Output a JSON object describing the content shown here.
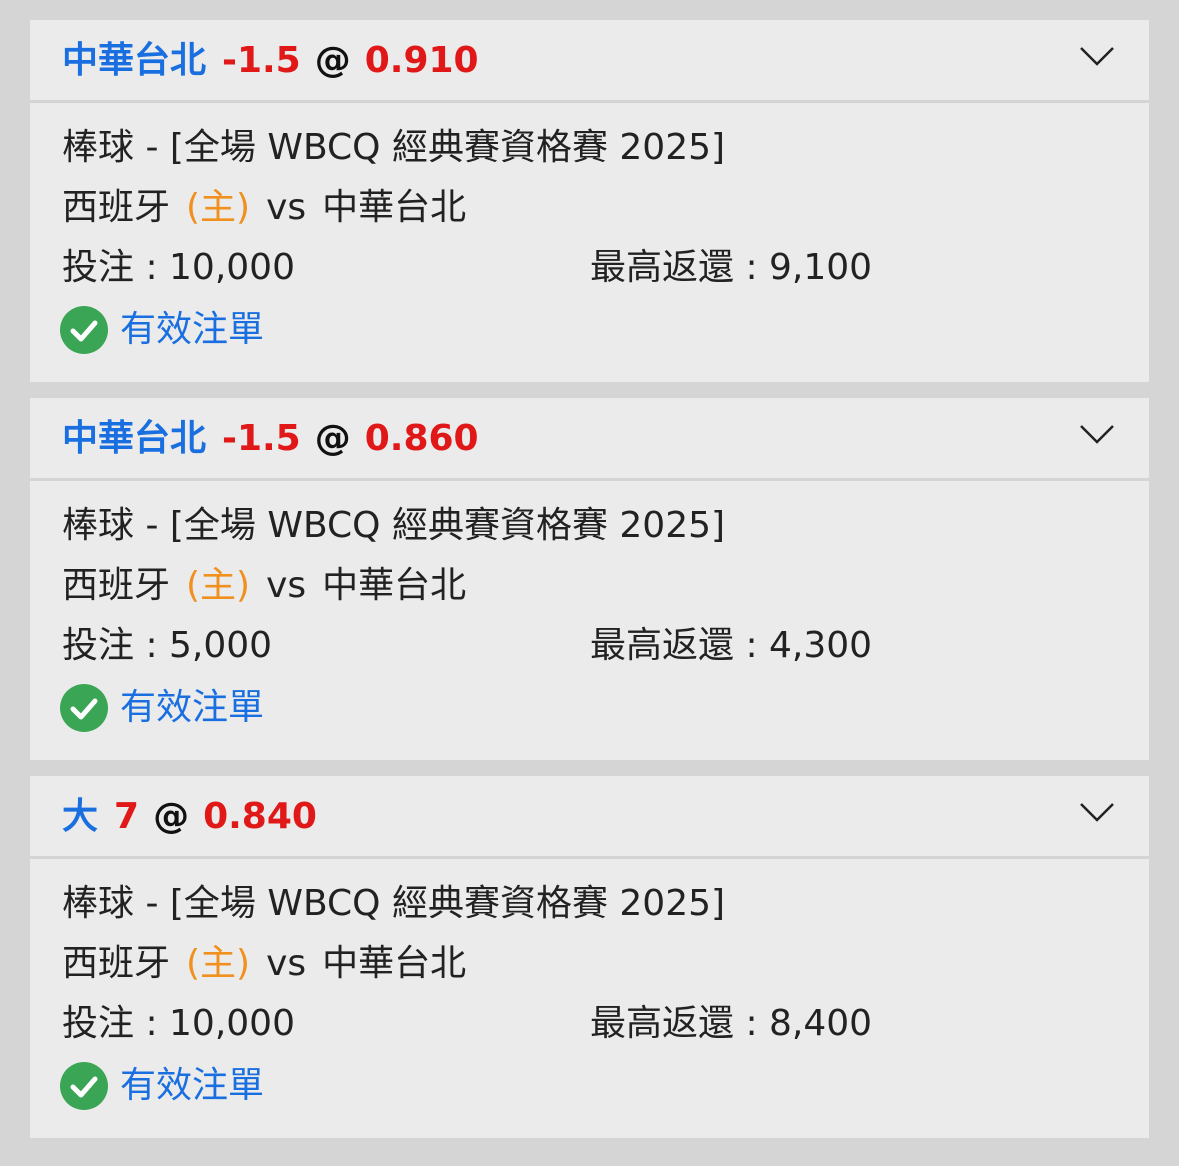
{
  "colors": {
    "team_blue": "#1a6fe0",
    "odds_red": "#e01818",
    "home_orange": "#f0901e",
    "valid_green": "#3aa655",
    "card_bg": "#ebebeb",
    "page_bg": "#d5d5d5"
  },
  "bets": [
    {
      "selection": "中華台北",
      "line": "-1.5",
      "at": "@",
      "odds": "0.910",
      "event": "棒球 - [全場 WBCQ 經典賽資格賽 2025]",
      "home_team": "西班牙",
      "home_tag": "(主)",
      "vs": "vs",
      "away_team": "中華台北",
      "stake_text": "投注 : 10,000",
      "max_return_text": "最高返還 : 9,100",
      "status": "有效注單",
      "status_icon": "check-circle-icon",
      "expand_icon": "chevron-down-icon"
    },
    {
      "selection": "中華台北",
      "line": "-1.5",
      "at": "@",
      "odds": "0.860",
      "event": "棒球 - [全場 WBCQ 經典賽資格賽 2025]",
      "home_team": "西班牙",
      "home_tag": "(主)",
      "vs": "vs",
      "away_team": "中華台北",
      "stake_text": "投注 : 5,000",
      "max_return_text": "最高返還 : 4,300",
      "status": "有效注單",
      "status_icon": "check-circle-icon",
      "expand_icon": "chevron-down-icon"
    },
    {
      "selection": "大",
      "line": "7",
      "at": "@",
      "odds": "0.840",
      "event": "棒球 - [全場 WBCQ 經典賽資格賽 2025]",
      "home_team": "西班牙",
      "home_tag": "(主)",
      "vs": "vs",
      "away_team": "中華台北",
      "stake_text": "投注 : 10,000",
      "max_return_text": "最高返還 : 8,400",
      "status": "有效注單",
      "status_icon": "check-circle-icon",
      "expand_icon": "chevron-down-icon"
    }
  ]
}
